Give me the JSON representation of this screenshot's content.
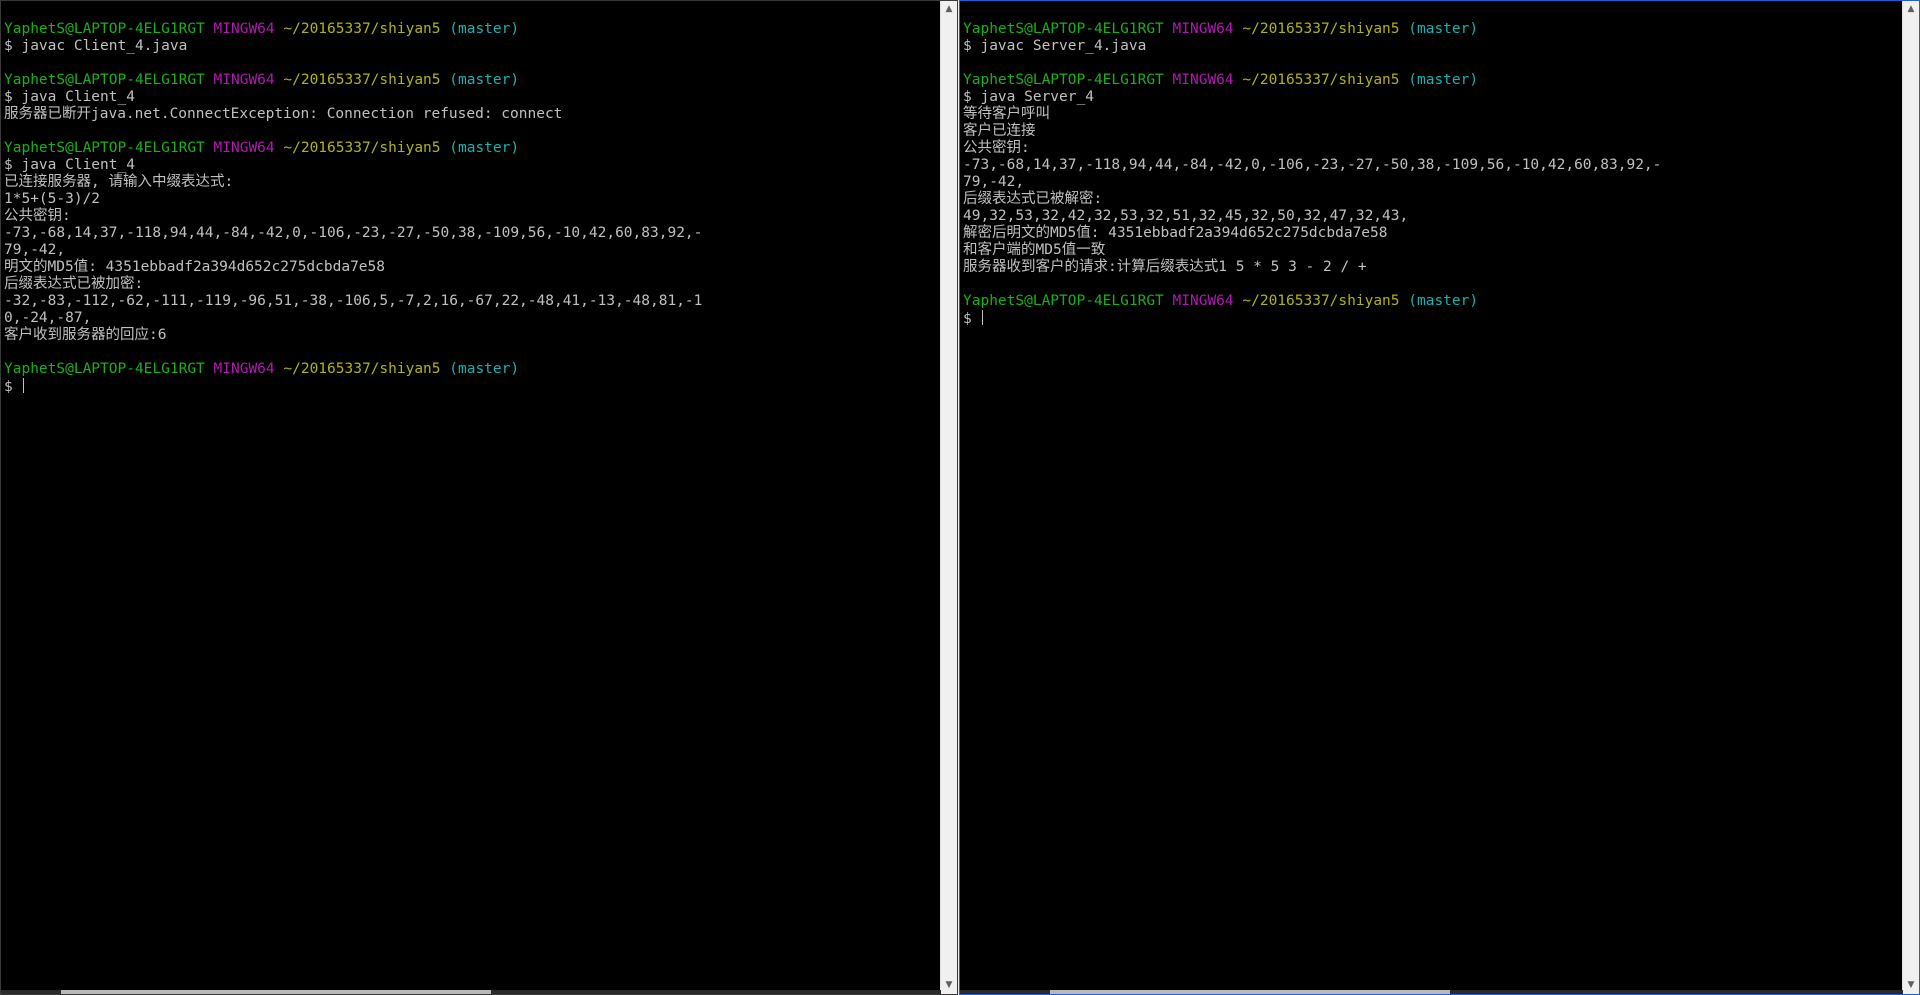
{
  "colors": {
    "user_host": "#18b218",
    "msystem": "#b218b2",
    "path": "#b2b218",
    "branch": "#18b2b2",
    "text": "#c0c0c0",
    "background": "#000000"
  },
  "left_terminal": {
    "lines": [
      {
        "type": "prompt",
        "user_host": "YaphetS@LAPTOP-4ELG1RGT",
        "msystem": "MINGW64",
        "path": "~/20165337/shiyan5",
        "branch": "(master)"
      },
      {
        "type": "text",
        "text": "$ javac Client_4.java"
      },
      {
        "type": "blank",
        "text": ""
      },
      {
        "type": "prompt",
        "user_host": "YaphetS@LAPTOP-4ELG1RGT",
        "msystem": "MINGW64",
        "path": "~/20165337/shiyan5",
        "branch": "(master)"
      },
      {
        "type": "text",
        "text": "$ java Client_4"
      },
      {
        "type": "text",
        "text": "服务器已断开java.net.ConnectException: Connection refused: connect"
      },
      {
        "type": "blank",
        "text": ""
      },
      {
        "type": "prompt",
        "user_host": "YaphetS@LAPTOP-4ELG1RGT",
        "msystem": "MINGW64",
        "path": "~/20165337/shiyan5",
        "branch": "(master)"
      },
      {
        "type": "text",
        "text": "$ java Client_4"
      },
      {
        "type": "text",
        "text": "已连接服务器, 请输入中缀表达式:"
      },
      {
        "type": "text",
        "text": "1*5+(5-3)/2"
      },
      {
        "type": "text",
        "text": "公共密钥:"
      },
      {
        "type": "text",
        "text": "-73,-68,14,37,-118,94,44,-84,-42,0,-106,-23,-27,-50,38,-109,56,-10,42,60,83,92,-"
      },
      {
        "type": "text",
        "text": "79,-42,"
      },
      {
        "type": "text",
        "text": "明文的MD5值: 4351ebbadf2a394d652c275dcbda7e58"
      },
      {
        "type": "text",
        "text": "后缀表达式已被加密:"
      },
      {
        "type": "text",
        "text": "-32,-83,-112,-62,-111,-119,-96,51,-38,-106,5,-7,2,16,-67,22,-48,41,-13,-48,81,-1"
      },
      {
        "type": "text",
        "text": "0,-24,-87,"
      },
      {
        "type": "text",
        "text": "客户收到服务器的回应:6"
      },
      {
        "type": "blank",
        "text": ""
      },
      {
        "type": "prompt",
        "user_host": "YaphetS@LAPTOP-4ELG1RGT",
        "msystem": "MINGW64",
        "path": "~/20165337/shiyan5",
        "branch": "(master)"
      },
      {
        "type": "cursorline",
        "text": "$ "
      }
    ]
  },
  "right_terminal": {
    "lines": [
      {
        "type": "prompt",
        "user_host": "YaphetS@LAPTOP-4ELG1RGT",
        "msystem": "MINGW64",
        "path": "~/20165337/shiyan5",
        "branch": "(master)"
      },
      {
        "type": "text",
        "text": "$ javac Server_4.java"
      },
      {
        "type": "blank",
        "text": ""
      },
      {
        "type": "prompt",
        "user_host": "YaphetS@LAPTOP-4ELG1RGT",
        "msystem": "MINGW64",
        "path": "~/20165337/shiyan5",
        "branch": "(master)"
      },
      {
        "type": "text",
        "text": "$ java Server_4"
      },
      {
        "type": "text",
        "text": "等待客户呼叫"
      },
      {
        "type": "text",
        "text": "客户已连接"
      },
      {
        "type": "text",
        "text": "公共密钥:"
      },
      {
        "type": "text",
        "text": "-73,-68,14,37,-118,94,44,-84,-42,0,-106,-23,-27,-50,38,-109,56,-10,42,60,83,92,-"
      },
      {
        "type": "text",
        "text": "79,-42,"
      },
      {
        "type": "text",
        "text": "后缀表达式已被解密:"
      },
      {
        "type": "text",
        "text": "49,32,53,32,42,32,53,32,51,32,45,32,50,32,47,32,43,"
      },
      {
        "type": "text",
        "text": "解密后明文的MD5值: 4351ebbadf2a394d652c275dcbda7e58"
      },
      {
        "type": "text",
        "text": "和客户端的MD5值一致"
      },
      {
        "type": "text",
        "text": "服务器收到客户的请求:计算后缀表达式1 5 * 5 3 - 2 / +"
      },
      {
        "type": "blank",
        "text": ""
      },
      {
        "type": "prompt",
        "user_host": "YaphetS@LAPTOP-4ELG1RGT",
        "msystem": "MINGW64",
        "path": "~/20165337/shiyan5",
        "branch": "(master)"
      },
      {
        "type": "cursorline",
        "text": "$ "
      }
    ]
  },
  "icons": {
    "scroll_up": "scroll-up-arrow-icon",
    "scroll_down": "scroll-down-arrow-icon"
  }
}
